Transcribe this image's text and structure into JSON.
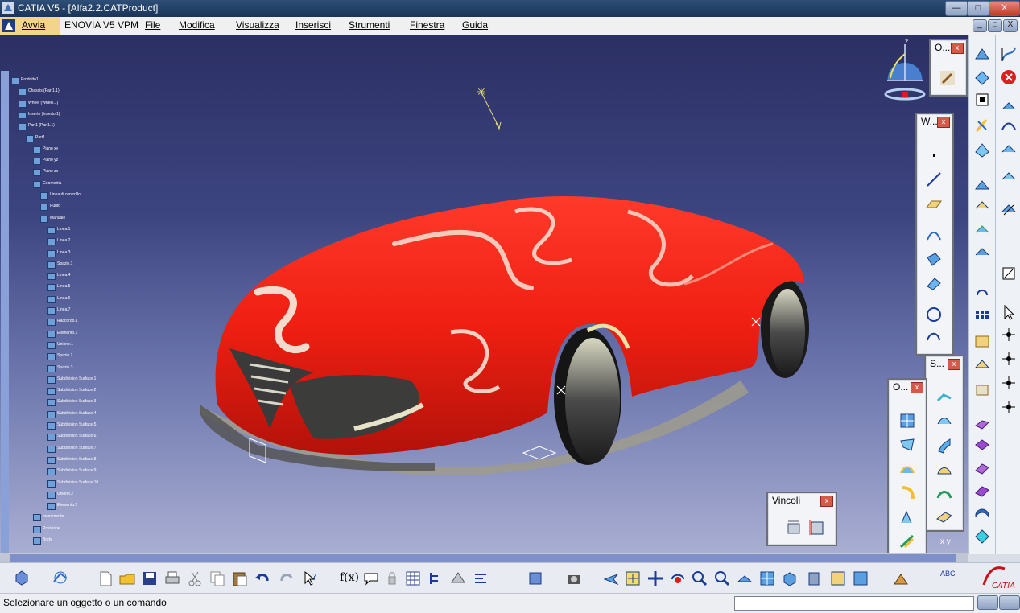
{
  "window": {
    "title": "CATIA V5 - [Alfa2.2.CATProduct]",
    "min_label": "—",
    "max_label": "□",
    "close_label": "X",
    "inner_min_label": "_",
    "inner_max_label": "□",
    "inner_close_label": "X"
  },
  "menu": {
    "items": [
      "Avvia",
      "ENOVIA V5 VPM",
      "File",
      "Modifica",
      "Visualizza",
      "Inserisci",
      "Strumenti",
      "Finestra",
      "Guida"
    ]
  },
  "tree": {
    "items": [
      "Prodotto1",
      "Chassis (Part1.1)",
      "Wheel (Wheel.1)",
      "Inserto (Inserto.1)",
      "Part1 (Part1.1)",
      "Part1",
      "Piano xy",
      "Piano yz",
      "Piano zx",
      "Geometria",
      "Linea di controllo",
      "Punto",
      "Manuale",
      "Linea.1",
      "Linea.2",
      "Linea.3",
      "Spazio.1",
      "Linea.4",
      "Linea.5",
      "Linea.6",
      "Linea.7",
      "Raccordo.1",
      "Elemento.1",
      "Unione.1",
      "Spazio.2",
      "Spazio.3",
      "Subdivision Surface.1",
      "Subdivision Surface.2",
      "Subdivision Surface.3",
      "Subdivision Surface.4",
      "Subdivision Surface.5",
      "Subdivision Surface.6",
      "Subdivision Surface.7",
      "Subdivision Surface.8",
      "Subdivision Surface.9",
      "Subdivision Surface.10",
      "Unione.2",
      "Elemento.2",
      "Inserimento",
      "Posizione",
      "Body"
    ]
  },
  "toolbars": {
    "o_top": "O...",
    "w": "W...",
    "s": "S...",
    "o_bottom": "O...",
    "vincoli": "Vincoli",
    "close_label": "x"
  },
  "compass": {
    "z_label": "z",
    "axes_label": "x  y"
  },
  "status": {
    "message": "Selezionare un oggetto o un comando"
  },
  "bottom_toolbar": {
    "fx_label": "f(x)",
    "abc_label": "ABC"
  },
  "brand": {
    "logo_text": "CATIA"
  }
}
